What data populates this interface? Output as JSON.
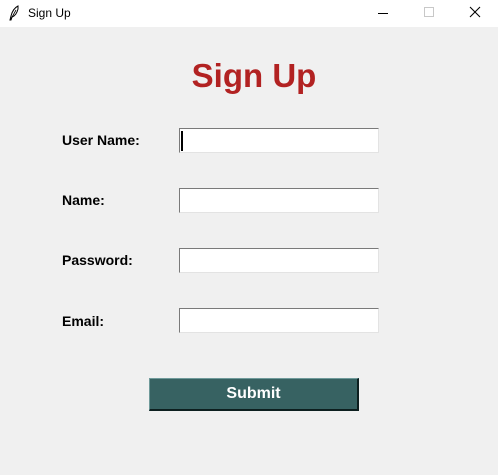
{
  "window": {
    "title": "Sign Up"
  },
  "form": {
    "heading": "Sign Up",
    "fields": [
      {
        "label": "User Name:",
        "value": ""
      },
      {
        "label": "Name:",
        "value": ""
      },
      {
        "label": "Password:",
        "value": ""
      },
      {
        "label": "Email:",
        "value": ""
      }
    ],
    "submit_label": "Submit"
  },
  "icons": {
    "app": "feather-icon",
    "minimize": "minimize-icon",
    "maximize": "maximize-icon",
    "close": "close-icon"
  },
  "colors": {
    "heading": "#b22222",
    "submit_bg": "#376262",
    "submit_text": "#ffffff",
    "window_bg": "#f0f0f0"
  }
}
